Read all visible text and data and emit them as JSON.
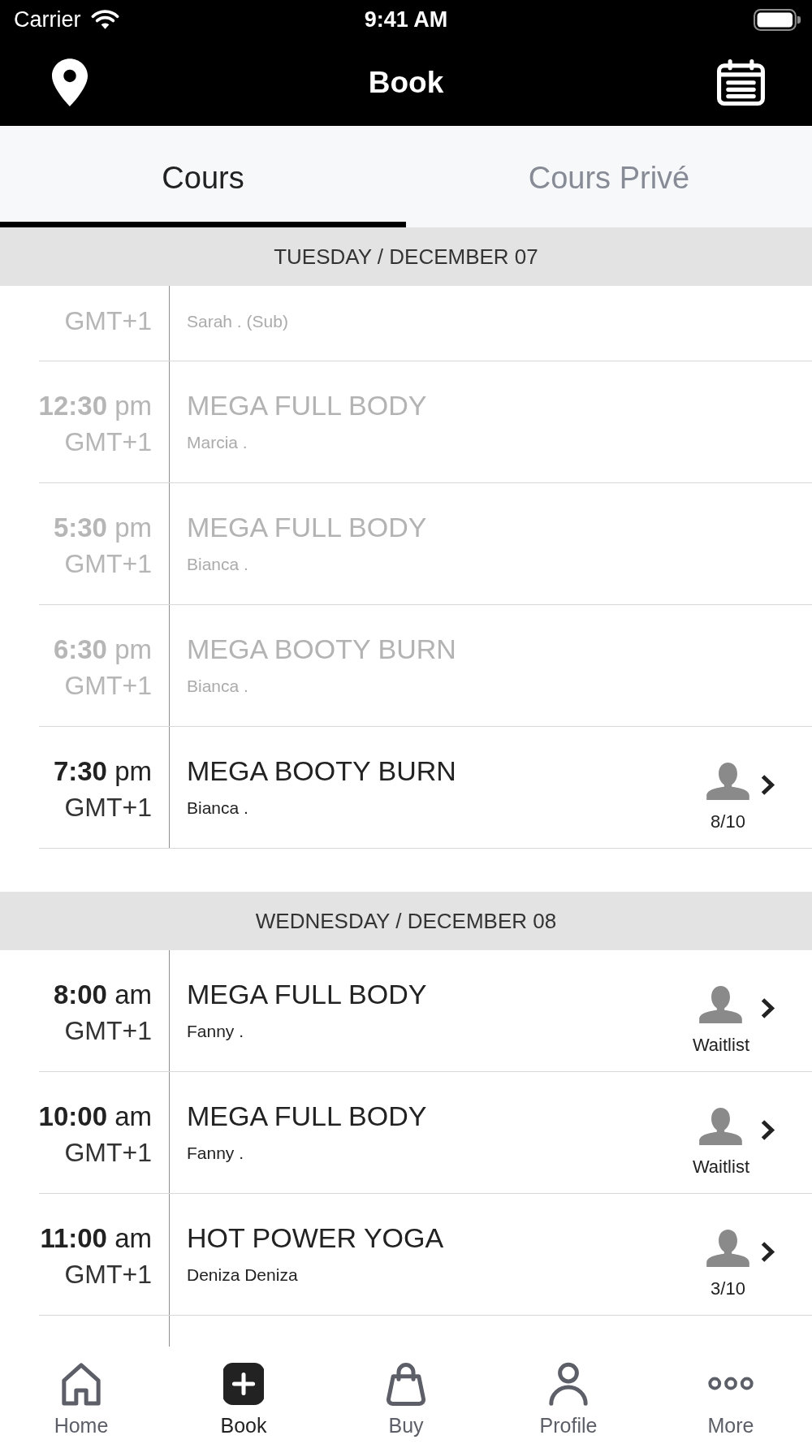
{
  "status_bar": {
    "carrier": "Carrier",
    "time": "9:41 AM"
  },
  "nav_bar": {
    "title": "Book"
  },
  "tabs": [
    {
      "label": "Cours",
      "selected": true
    },
    {
      "label": "Cours Privé",
      "selected": false
    }
  ],
  "schedule": [
    {
      "date": "TUESDAY / DECEMBER 07",
      "classes": [
        {
          "timezone": "GMT+1",
          "instructor": "Sarah . (Sub)",
          "past": true
        },
        {
          "time": "**12:30** pm",
          "timezone": "GMT+1",
          "title": "MEGA FULL BODY",
          "instructor": "Marcia .",
          "past": true
        },
        {
          "time": "**5:30** pm",
          "timezone": "GMT+1",
          "title": "MEGA FULL BODY",
          "instructor": "Bianca .",
          "past": true
        },
        {
          "time": "**6:30** pm",
          "timezone": "GMT+1",
          "title": "MEGA BOOTY BURN",
          "instructor": "Bianca .",
          "past": true
        },
        {
          "time": "**7:30** pm",
          "timezone": "GMT+1",
          "title": "MEGA BOOTY BURN",
          "instructor": "Bianca .",
          "past": false,
          "spots": "8/10"
        }
      ]
    },
    {
      "date": "WEDNESDAY / DECEMBER 08",
      "classes": [
        {
          "time": "**8:00** am",
          "timezone": "GMT+1",
          "title": "MEGA FULL BODY",
          "instructor": "Fanny .",
          "past": false,
          "spots": "Waitlist"
        },
        {
          "time": "**10:00** am",
          "timezone": "GMT+1",
          "title": "MEGA FULL BODY",
          "instructor": "Fanny .",
          "past": false,
          "spots": "Waitlist"
        },
        {
          "time": "**11:00** am",
          "timezone": "GMT+1",
          "title": "HOT POWER YOGA",
          "instructor": "Deniza Deniza",
          "past": false,
          "spots": "3/10"
        }
      ]
    }
  ],
  "tab_bar": [
    {
      "label": "Home",
      "selected": false
    },
    {
      "label": "Book",
      "selected": true
    },
    {
      "label": "Buy",
      "selected": false
    },
    {
      "label": "Profile",
      "selected": false
    },
    {
      "label": "More",
      "selected": false
    }
  ]
}
